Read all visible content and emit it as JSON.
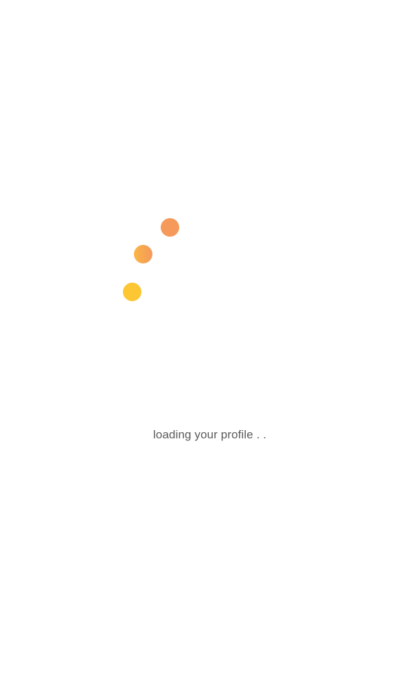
{
  "loader": {
    "dots": [
      {
        "color": "#f59a5a"
      },
      {
        "color": "#f7a552"
      },
      {
        "color": "#fdc734"
      }
    ]
  },
  "status": {
    "text": "loading your profile . ."
  }
}
